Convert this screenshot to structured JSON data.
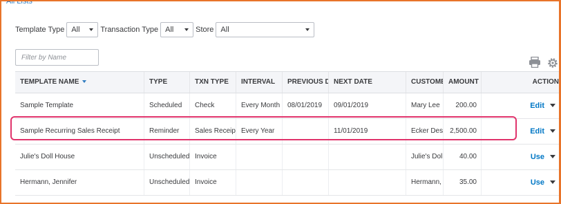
{
  "breadcrumb": "All Lists",
  "filters": {
    "template_type": {
      "label": "Template Type",
      "value": "All"
    },
    "transaction_type": {
      "label": "Transaction Type",
      "value": "All"
    },
    "store": {
      "label": "Store",
      "value": "All"
    }
  },
  "filter_by_name": {
    "placeholder": "Filter by Name"
  },
  "toolbar": {
    "print_icon": "printer-icon",
    "settings_icon": "gear-icon"
  },
  "table": {
    "columns": [
      "TEMPLATE NAME",
      "TYPE",
      "TXN TYPE",
      "INTERVAL",
      "PREVIOUS DATE",
      "NEXT DATE",
      "CUSTOMER",
      "AMOUNT",
      "ACTION"
    ],
    "sort_column": "TEMPLATE NAME",
    "rows": [
      {
        "name": "Sample Template",
        "type": "Scheduled",
        "txn_type": "Check",
        "interval": "Every Month",
        "previous_date": "08/01/2019",
        "next_date": "09/01/2019",
        "customer": "Mary Lee",
        "amount": "200.00",
        "action": "Edit"
      },
      {
        "name": "Sample Recurring Sales Receipt",
        "type": "Reminder",
        "txn_type": "Sales Receipt",
        "interval": "Every Year",
        "previous_date": "",
        "next_date": "11/01/2019",
        "customer": "Ecker Designs",
        "amount": "2,500.00",
        "action": "Edit"
      },
      {
        "name": "Julie's Doll House",
        "type": "Unscheduled",
        "txn_type": "Invoice",
        "interval": "",
        "previous_date": "",
        "next_date": "",
        "customer": "Julie's Doll House",
        "amount": "40.00",
        "action": "Use"
      },
      {
        "name": "Hermann, Jennifer",
        "type": "Unscheduled",
        "txn_type": "Invoice",
        "interval": "",
        "previous_date": "",
        "next_date": "",
        "customer": "Hermann, Jennifer",
        "amount": "35.00",
        "action": "Use"
      }
    ]
  },
  "colors": {
    "accent_link": "#0077c5",
    "frame": "#e8742a",
    "highlight": "#e0336b",
    "header_bg": "#f4f5f8"
  }
}
